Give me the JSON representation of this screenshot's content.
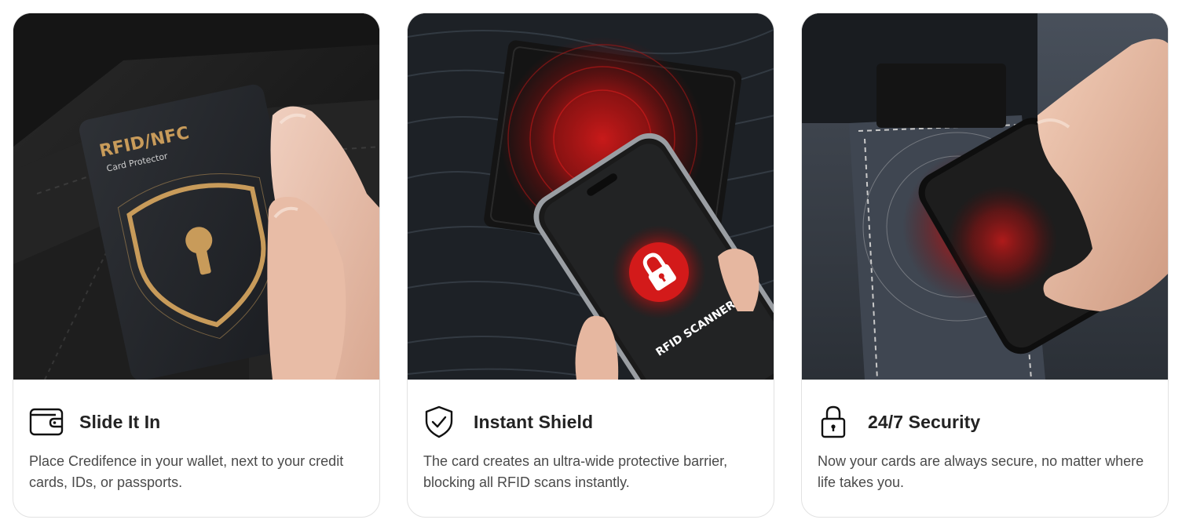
{
  "features": [
    {
      "title": "Slide It In",
      "description": "Place Credifence in your wallet, next to your credit cards, IDs, or passports.",
      "icon": "wallet-icon",
      "photo": {
        "card_title": "RFID/NFC",
        "card_subtitle": "Card Protector"
      }
    },
    {
      "title": "Instant Shield",
      "description": "The card creates an ultra-wide protective barrier, blocking all RFID scans instantly.",
      "icon": "shield-check-icon",
      "photo": {
        "screen_label": "RFID SCANNER"
      }
    },
    {
      "title": "24/7 Security",
      "description": "Now your cards are always secure, no matter where life takes you.",
      "icon": "padlock-icon",
      "photo": {}
    }
  ],
  "colors": {
    "signal_red": "#d11a1a",
    "gold": "#c89b5a",
    "text_dark": "#222222",
    "text_muted": "#4a4a4a"
  }
}
